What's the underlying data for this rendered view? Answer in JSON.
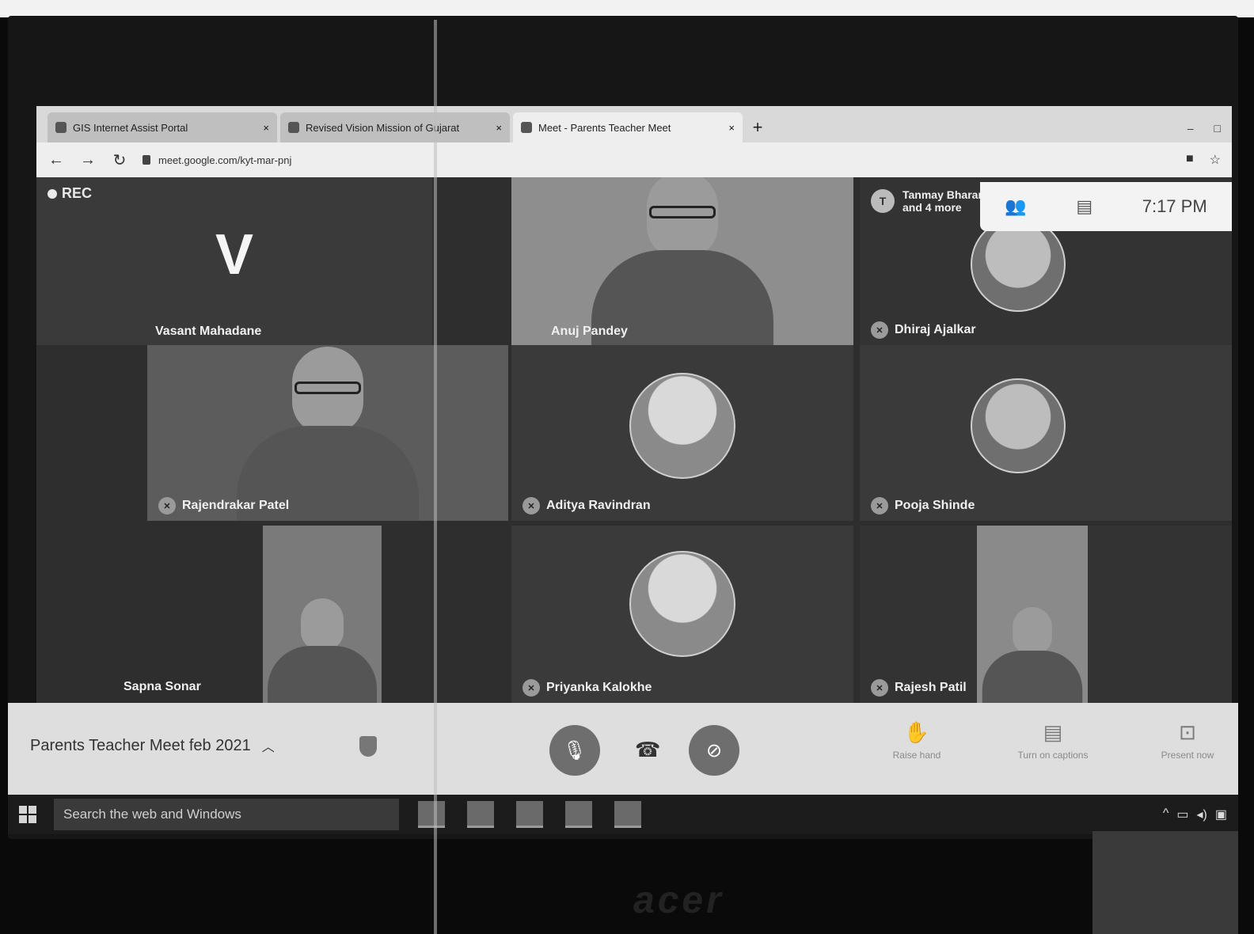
{
  "browser": {
    "tabs": [
      {
        "label": "GIS Internet Assist Portal",
        "active": false
      },
      {
        "label": "Revised Vision Mission of Gujarat",
        "active": false
      },
      {
        "label": "Meet - Parents Teacher Meet",
        "active": true
      }
    ],
    "new_tab": "+",
    "url": "meet.google.com/kyt-mar-pnj",
    "nav": {
      "back": "←",
      "forward": "→",
      "reload": "↻"
    },
    "window_controls": {
      "minimize": "–",
      "maximize": "□",
      "close": "×"
    }
  },
  "meet": {
    "rec_label": "REC",
    "clock": "7:17 PM",
    "overflow_chip": {
      "initial": "T",
      "line1": "Tanmay Bharam...",
      "line2": "and 4 more"
    },
    "participants": [
      {
        "name": "Vasant Mahadane",
        "initial": "V",
        "mode": "initial"
      },
      {
        "name": "Anuj Pandey",
        "mode": "camera"
      },
      {
        "name": "Dhiraj Ajalkar",
        "mode": "avatar"
      },
      {
        "name": "Rajendrakar Patel",
        "mode": "camera"
      },
      {
        "name": "Aditya Ravindran",
        "mode": "avatar"
      },
      {
        "name": "Pooja Shinde",
        "mode": "avatar"
      },
      {
        "name": "Sapna Sonar",
        "mode": "camera"
      },
      {
        "name": "Priyanka Kalokhe",
        "mode": "avatar"
      },
      {
        "name": "Rajesh Patil",
        "mode": "camera"
      }
    ]
  },
  "controls": {
    "meeting_title": "Parents Teacher Meet feb 2021",
    "mic_icon": "🎙",
    "hangup_icon": "☎",
    "camera_icon": "⊘",
    "actions": [
      {
        "label": "Raise hand",
        "icon": "✋"
      },
      {
        "label": "Turn on captions",
        "icon": "▤"
      },
      {
        "label": "Present now",
        "icon": "⊡"
      }
    ]
  },
  "taskbar": {
    "search_placeholder": "Search the web and Windows"
  },
  "hardware": {
    "brand": "acer"
  }
}
